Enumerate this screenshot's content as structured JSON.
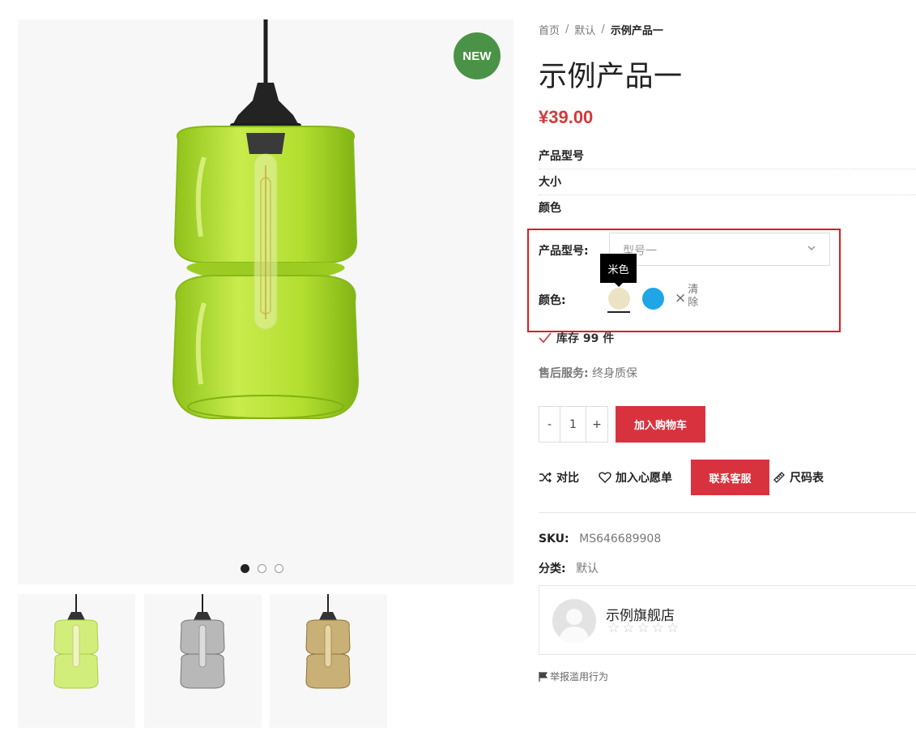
{
  "badge": {
    "label": "NEW"
  },
  "gallery": {
    "slides": 3,
    "active_slide": 1,
    "thumbnails": [
      "绿色",
      "灰色",
      "琥珀色"
    ]
  },
  "breadcrumb": {
    "home": "首页",
    "category": "默认",
    "current": "示例产品一",
    "separator": "/"
  },
  "product": {
    "title": "示例产品一",
    "price": "¥39.00",
    "attributes": [
      "产品型号",
      "大小",
      "颜色"
    ]
  },
  "variations": {
    "model_label": "产品型号:",
    "model_value": "型号一",
    "color_label": "颜色:",
    "tooltip": "米色",
    "swatches": [
      {
        "name": "米色",
        "color": "#ece3c5",
        "selected": true
      },
      {
        "name": "蓝色",
        "color": "#1ea6e6",
        "selected": false
      }
    ],
    "clear_label": "清除"
  },
  "stock": {
    "text": "库存 99 件"
  },
  "after_sales": {
    "label": "售后服务:",
    "value": "终身质保"
  },
  "cart": {
    "minus": "-",
    "quantity": "1",
    "plus": "+",
    "add_label": "加入购物车"
  },
  "actions": {
    "compare": "对比",
    "wishlist": "加入心愿单",
    "contact": "联系客服",
    "size_chart": "尺码表"
  },
  "meta": {
    "sku_label": "SKU:",
    "sku_value": "MS646689908",
    "category_label": "分类:",
    "category_value": "默认"
  },
  "store": {
    "name": "示例旗舰店",
    "stars": "☆☆☆☆☆",
    "rating": 0
  },
  "report": {
    "label": "举报滥用行为"
  },
  "colors": {
    "accent": "#d9323f",
    "price": "#d23a3a",
    "badge": "#4a9346",
    "highlight_box": "#e01c1c"
  }
}
